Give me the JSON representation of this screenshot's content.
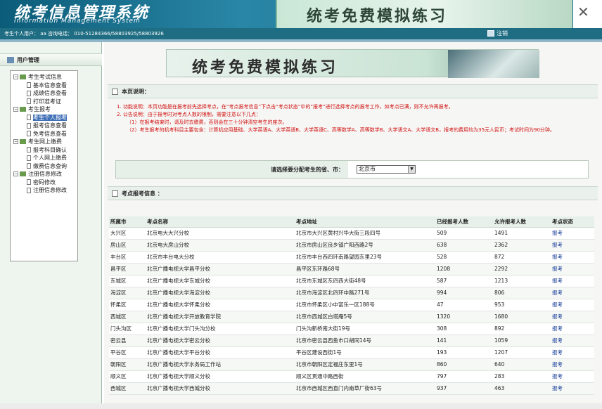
{
  "header": {
    "title": "统考信息管理系统",
    "subtitle": "Information Management System",
    "banner": "统考免费模拟练习",
    "close": "✕"
  },
  "infobar": {
    "user": "考生个人用户：",
    "user_value": "aa",
    "phone_label": "咨询电话：",
    "phone": "010-51284366/58803925/58803926",
    "logout": "注销"
  },
  "sidebar": {
    "title": "用户管理",
    "groups": [
      {
        "label": "考生考试信息",
        "items": [
          "基本信息查看",
          "成绩信息查看",
          "打印准考证"
        ]
      },
      {
        "label": "考生报考",
        "items": [
          "考生个人报考",
          "报考信息查看",
          "免考信息查看"
        ]
      },
      {
        "label": "考生网上缴费",
        "items": [
          "报考科目确认",
          "个人网上缴费",
          "缴费信息查询"
        ]
      },
      {
        "label": "注册信息修改",
        "items": [
          "密码修改",
          "注册信息修改"
        ]
      }
    ]
  },
  "main": {
    "banner": "统考免费模拟练习",
    "notice_title": "本页说明：",
    "notice_lines": [
      "1. 功能说明：本页功能是在报考前先选择考点，在“考点报考信息”下点击“考点状态”中的“报考”进行选择考点的报考工作，如考点已满，则不允许再报考。",
      "2. 公告说明：由于报考时对考点人数的限制，需要注意以下几点：",
      "（1）在报考结束时，请及时去缴费，否则会在三十分钟清空考生的座次。",
      "（2）考生报考的机考科目主要包含：计算机应用基础、大学英语A、大学英语B、大学英语C、高等数学A、高等数学B、大学语文A、大学语文B，报考的费用均为35元人民币；考试时间为90分钟。"
    ],
    "selector_label": "请选择要分配考生的省、市：",
    "selected_city": "北京市",
    "table_title": "考点报考信息 ：",
    "columns": [
      "所属市",
      "考点名称",
      "考点地址",
      "已经报考人数",
      "允许报考人数",
      "考点状态"
    ],
    "rows": [
      [
        "大兴区",
        "北京电大大兴分校",
        "北京市大兴区黄村兴华大街三段四号",
        "509",
        "1491",
        "报考"
      ],
      [
        "房山区",
        "北京电大房山分校",
        "北京市房山区良乡镇广阳西路2号",
        "638",
        "2362",
        "报考"
      ],
      [
        "丰台区",
        "北京市丰台电大分校",
        "北京市丰台西四环南路望园东里23号",
        "528",
        "872",
        "报考"
      ],
      [
        "昌平区",
        "北京广播电视大学昌平分校",
        "昌平区东环路68号",
        "1208",
        "2292",
        "报考"
      ],
      [
        "东城区",
        "北京广播电视大学东城分校",
        "北京市东城区东四西大街48号",
        "587",
        "1213",
        "报考"
      ],
      [
        "海淀区",
        "北京广播电视大学海淀分校",
        "北京市海淀区北四环中路271号",
        "994",
        "806",
        "报考"
      ],
      [
        "怀柔区",
        "北京广播电视大学怀柔分校",
        "北京市怀柔区小中富乐一区188号",
        "47",
        "953",
        "报考"
      ],
      [
        "西城区",
        "北京广播电视大学开放教育学院",
        "北京市西城区白塔庵5号",
        "1320",
        "1680",
        "报考"
      ],
      [
        "门头沟区",
        "北京广播电视大学门头沟分校",
        "门头沟新桥南大街19号",
        "308",
        "892",
        "报考"
      ],
      [
        "密云县",
        "北京广播电视大学密云分校",
        "北京市密云县西鱼市口胡同14号",
        "141",
        "1059",
        "报考"
      ],
      [
        "平谷区",
        "北京广播电视大学平谷分校",
        "平谷区建设西街1号",
        "193",
        "1207",
        "报考"
      ],
      [
        "朝阳区",
        "北京广播电视大学水务局工作站",
        "北京市朝阳区定福庄东里1号",
        "860",
        "640",
        "报考"
      ],
      [
        "顺义区",
        "北京广播电视大学顺义分校",
        "顺义区贯通中路西街",
        "797",
        "283",
        "报考"
      ],
      [
        "西城区",
        "北京广播电视大学西城分校",
        "北京市西城区西直门内南草厂街63号",
        "937",
        "463",
        "报考"
      ]
    ]
  }
}
